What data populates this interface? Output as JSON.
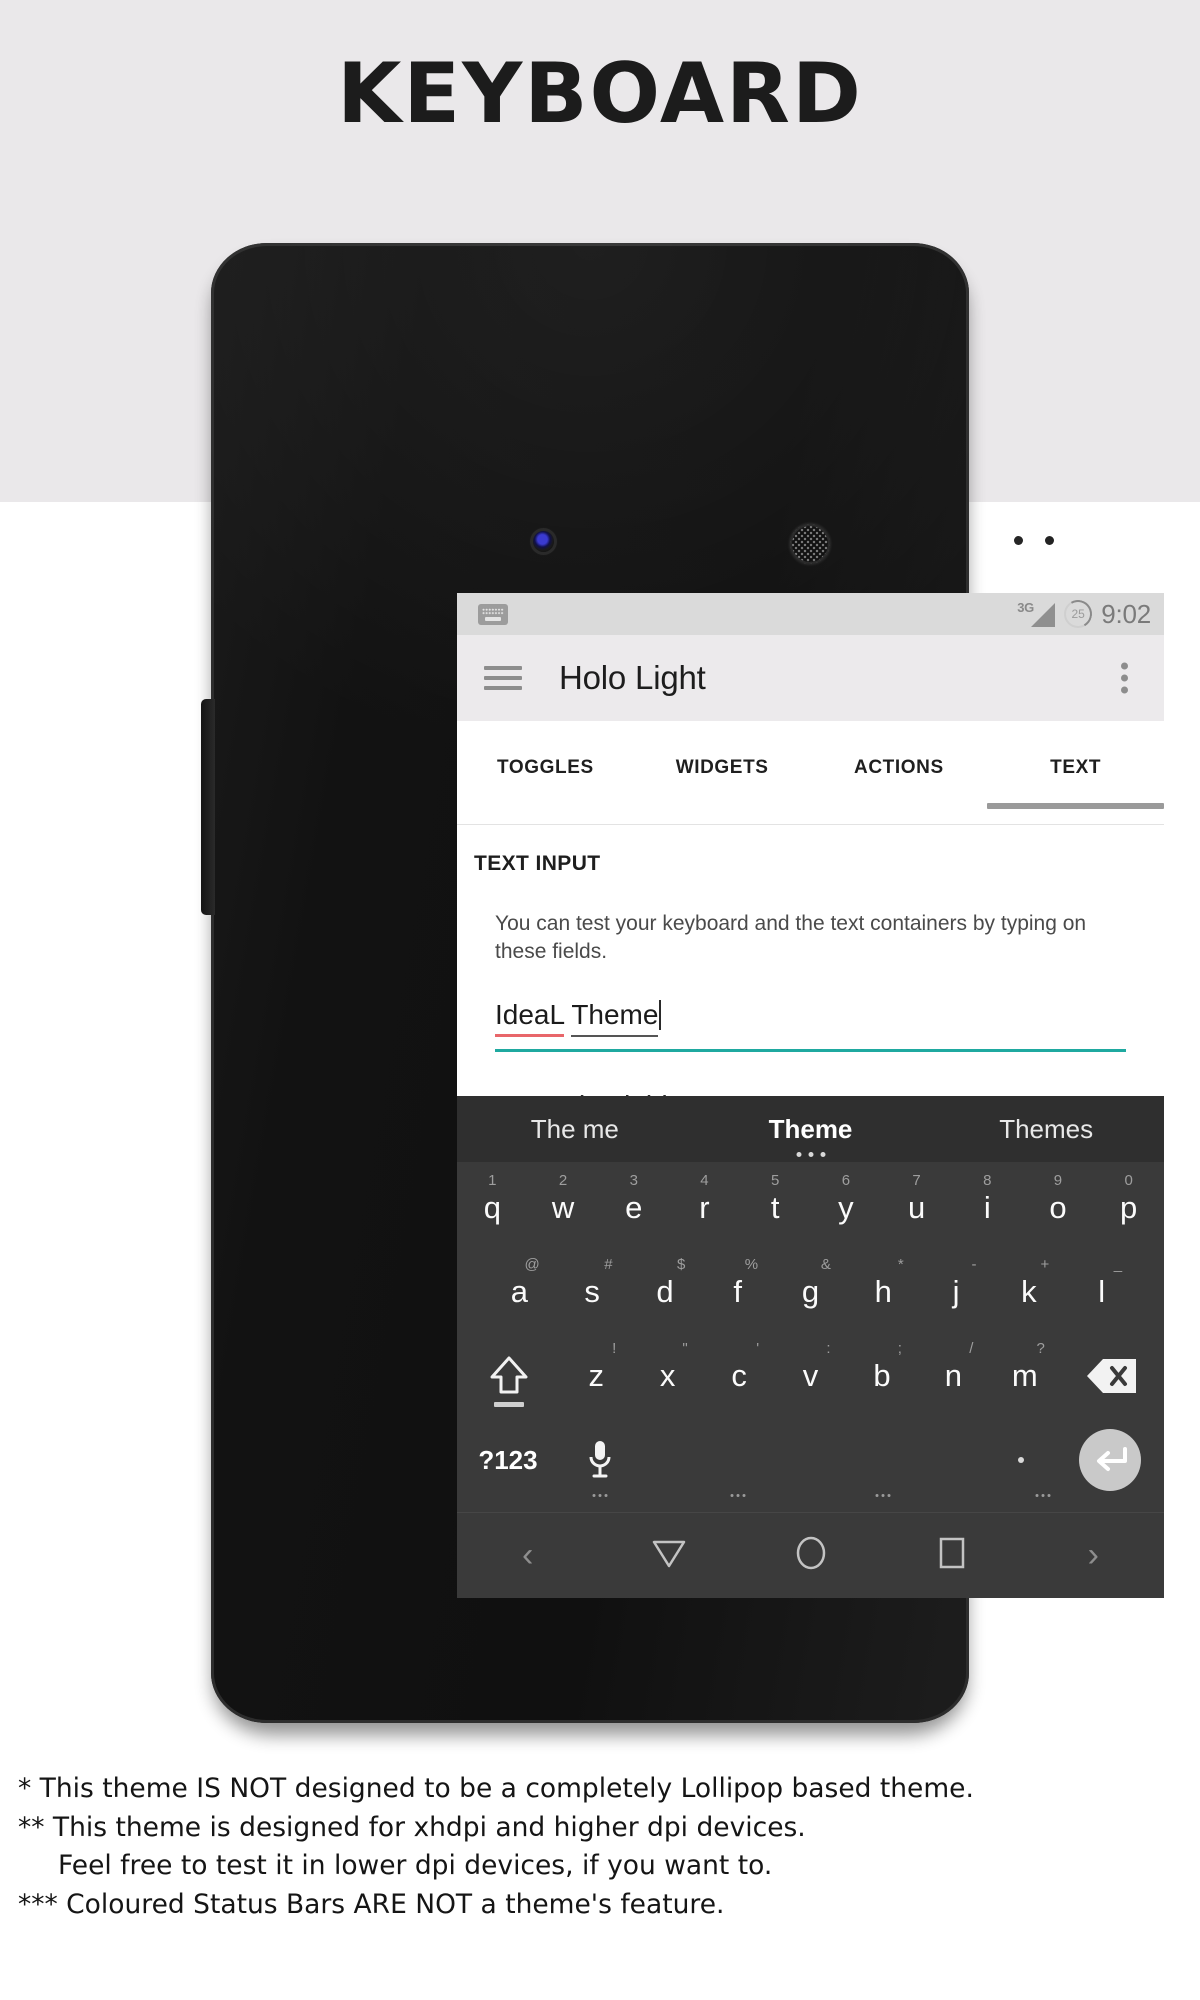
{
  "banner": {
    "title": "KEYBOARD"
  },
  "phone": {
    "status_bar": {
      "keyboard_icon": "keyboard-icon",
      "network": "3G",
      "battery_level": "25",
      "time": "9:02"
    },
    "app_bar": {
      "menu_icon": "hamburger-menu-icon",
      "title": "Holo Light",
      "overflow_icon": "overflow-menu-icon"
    },
    "tabs": [
      {
        "label": "TOGGLES",
        "active": false
      },
      {
        "label": "WIDGETS",
        "active": false
      },
      {
        "label": "ACTIONS",
        "active": false
      },
      {
        "label": "TEXT",
        "active": true
      }
    ],
    "content": {
      "section_label": "TEXT INPUT",
      "helper_text": "You can test your keyboard and the text containers by typing on these fields.",
      "text_field": {
        "word_misspelled": "IdeaL",
        "word_composing": "Theme",
        "accent_color": "#1fa9a0",
        "spellcheck_color": "#e8666a"
      },
      "numeric_field": {
        "placeholder": "Numeric Field"
      }
    },
    "keyboard": {
      "suggestions": [
        {
          "text": "The me",
          "active": false
        },
        {
          "text": "Theme",
          "active": true
        },
        {
          "text": "Themes",
          "active": false
        }
      ],
      "row1": [
        {
          "main": "q",
          "sub": "1"
        },
        {
          "main": "w",
          "sub": "2"
        },
        {
          "main": "e",
          "sub": "3"
        },
        {
          "main": "r",
          "sub": "4"
        },
        {
          "main": "t",
          "sub": "5"
        },
        {
          "main": "y",
          "sub": "6"
        },
        {
          "main": "u",
          "sub": "7"
        },
        {
          "main": "i",
          "sub": "8"
        },
        {
          "main": "o",
          "sub": "9"
        },
        {
          "main": "p",
          "sub": "0"
        }
      ],
      "row2": [
        {
          "main": "a",
          "sub": "@"
        },
        {
          "main": "s",
          "sub": "#"
        },
        {
          "main": "d",
          "sub": "$"
        },
        {
          "main": "f",
          "sub": "%"
        },
        {
          "main": "g",
          "sub": "&"
        },
        {
          "main": "h",
          "sub": "*"
        },
        {
          "main": "j",
          "sub": "-"
        },
        {
          "main": "k",
          "sub": "+"
        },
        {
          "main": "l",
          "sub": "_"
        }
      ],
      "row3": [
        {
          "main": "z",
          "sub": "!"
        },
        {
          "main": "x",
          "sub": "\""
        },
        {
          "main": "c",
          "sub": "'"
        },
        {
          "main": "v",
          "sub": ":"
        },
        {
          "main": "b",
          "sub": ";"
        },
        {
          "main": "n",
          "sub": "/"
        },
        {
          "main": "m",
          "sub": "?"
        }
      ],
      "shift_icon": "shift-icon",
      "delete_icon": "backspace-icon",
      "symbols_key": "?123",
      "mic_icon": "microphone-icon",
      "space_key": "space-key",
      "period_key": ".",
      "enter_icon": "enter-icon"
    },
    "nav_bar": {
      "left_chevron": "‹",
      "back_icon": "hide-keyboard-icon",
      "home_icon": "home-icon",
      "recents_icon": "recents-icon",
      "right_chevron": "›"
    }
  },
  "notes": [
    "* This theme IS NOT designed to be a completely Lollipop based theme.",
    "** This theme is designed for xhdpi and higher dpi devices.",
    "Feel free to test it in lower dpi devices, if you want to.",
    "*** Coloured Status Bars ARE NOT a theme's feature."
  ]
}
